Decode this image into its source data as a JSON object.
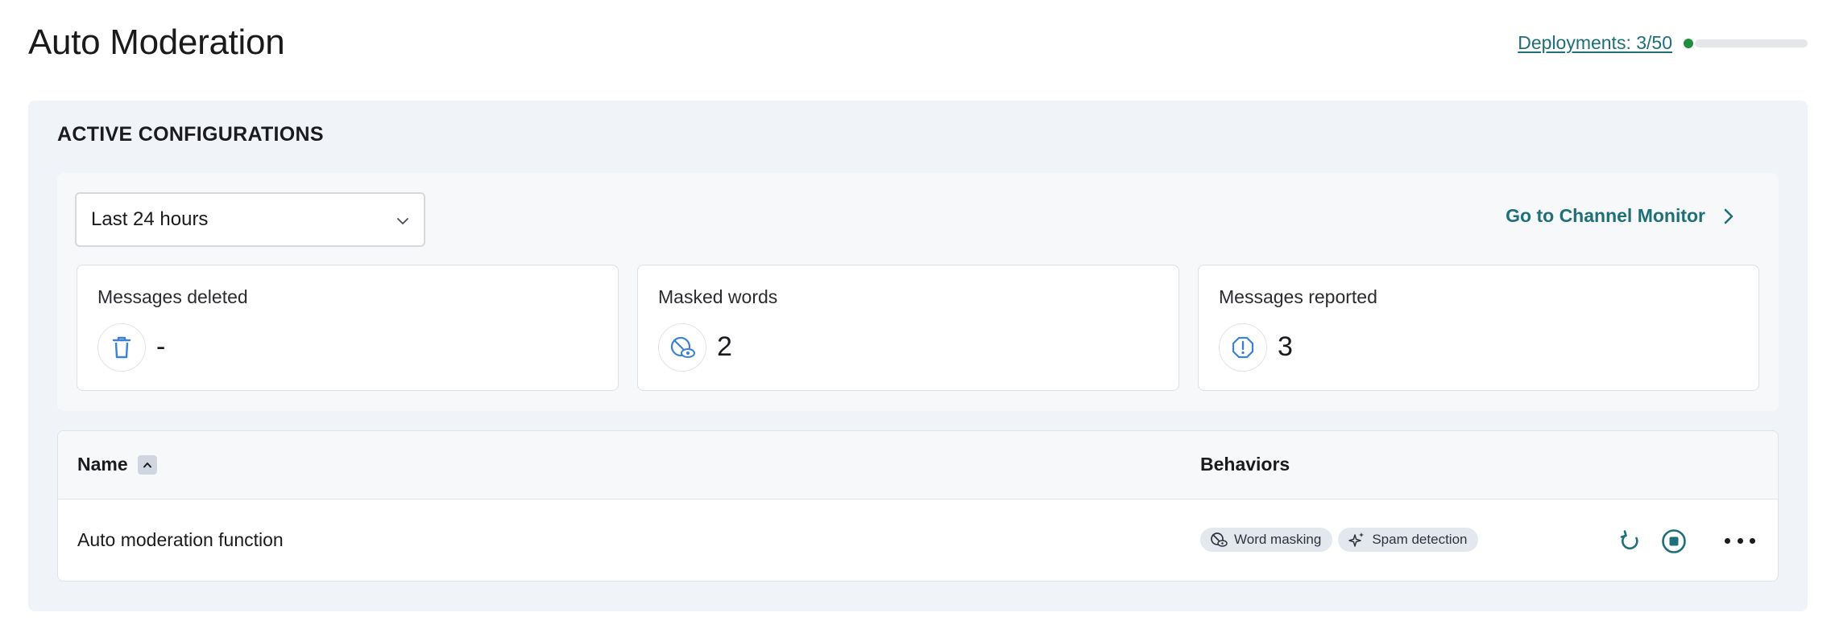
{
  "header": {
    "title": "Auto Moderation",
    "deployments_label": "Deployments: 3/50",
    "deployments_used": 3,
    "deployments_limit": 50
  },
  "section": {
    "title": "ACTIVE CONFIGURATIONS"
  },
  "filters": {
    "time_range": "Last 24 hours",
    "monitor_link": "Go to Channel Monitor"
  },
  "stats": [
    {
      "label": "Messages deleted",
      "value": "-",
      "icon": "trash-icon"
    },
    {
      "label": "Masked words",
      "value": "2",
      "icon": "eye-slash-icon"
    },
    {
      "label": "Messages reported",
      "value": "3",
      "icon": "alert-octagon-icon"
    }
  ],
  "table": {
    "columns": {
      "name": "Name",
      "behaviors": "Behaviors"
    },
    "rows": [
      {
        "name": "Auto moderation function",
        "behaviors": [
          "Word masking",
          "Spam detection"
        ]
      }
    ]
  },
  "colors": {
    "accent": "#1f6f78",
    "status_green": "#1e8e3e",
    "icon_blue": "#3b82d6",
    "panel_bg": "#f0f3f7"
  }
}
